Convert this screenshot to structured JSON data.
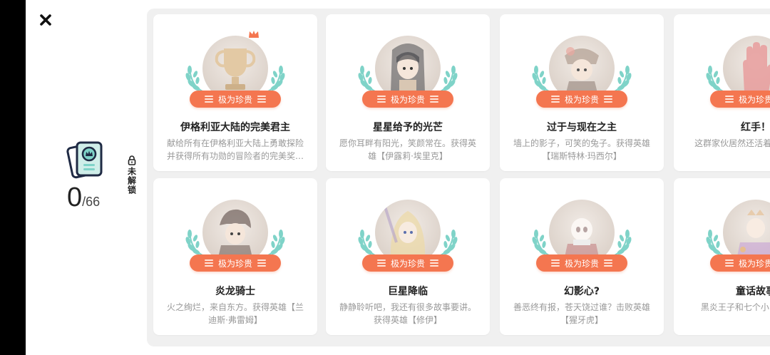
{
  "header": {
    "close_icon": "close-icon"
  },
  "stats": {
    "unlocked_count": "0",
    "total": "/66",
    "lock_label": "未解锁",
    "icon": "achievement-book-icon"
  },
  "colors": {
    "badge": "#f47650",
    "laurel": "#7fd3c8",
    "crown": "#f47650"
  },
  "cards": [
    {
      "title": "伊格利亚大陆的完美君主",
      "badge": "极为珍贵",
      "desc": "献给所有在伊格利亚大陆上勇敢探险并获得所有功勋的冒险者的完美奖…",
      "icon": "trophy-icon"
    },
    {
      "title": "星星给予的光芒",
      "badge": "极为珍贵",
      "desc": "愿你耳畔有阳光，笑颜常在。获得英雄【伊露莉·埃里克】",
      "icon": "hero-portrait"
    },
    {
      "title": "过于与现在之主",
      "badge": "极为珍贵",
      "desc": "墙上的影子，可笑的兔子。获得英雄【瑞斯特林·玛西尔】",
      "icon": "hero-portrait"
    },
    {
      "title": "红手！",
      "badge": "极为珍贵",
      "desc": "这群家伙居然还活着？ 体成员。",
      "icon": "red-hand-icon"
    },
    {
      "title": "炎龙骑士",
      "badge": "极为珍贵",
      "desc": "火之绚烂，来自东方。获得英雄【兰迪斯·弗雷姆】",
      "icon": "hero-portrait"
    },
    {
      "title": "巨星降临",
      "badge": "极为珍贵",
      "desc": "静静聆听吧，我还有很多故事要讲。获得英雄【修伊】",
      "icon": "hero-portrait"
    },
    {
      "title": "幻影心?",
      "badge": "极为珍贵",
      "desc": "善恶终有报，苍天饶过谁？击败英雄【猩牙虎】",
      "icon": "hero-portrait"
    },
    {
      "title": "童话故事",
      "badge": "极为珍贵",
      "desc": "黑炎王子和七个小巨人 姓名?",
      "icon": "hero-portrait"
    }
  ]
}
